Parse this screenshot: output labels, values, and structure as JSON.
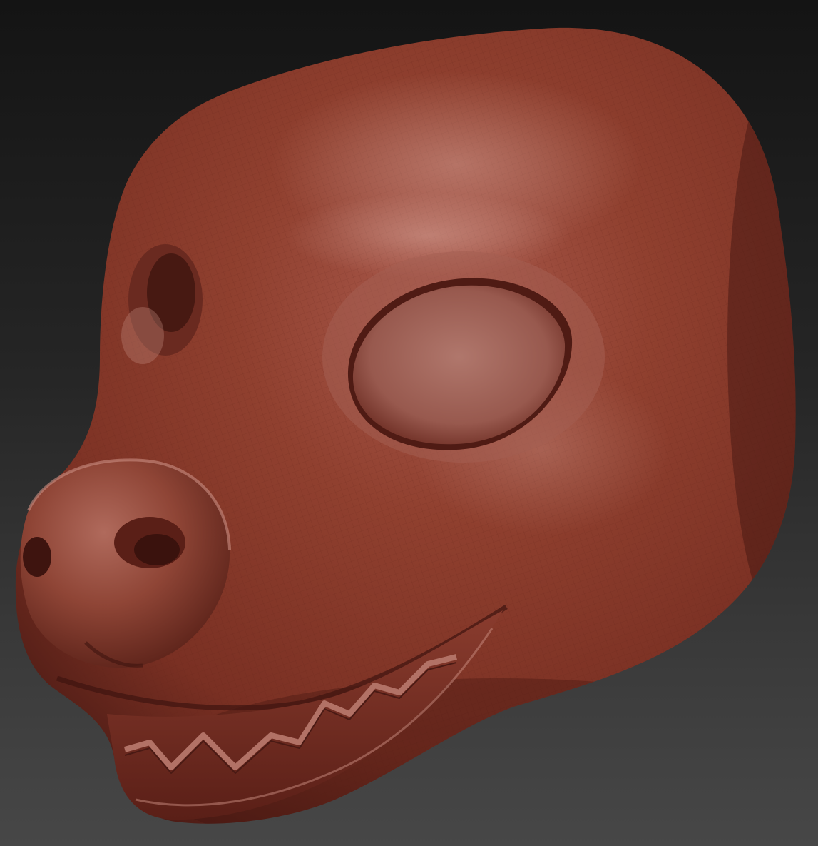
{
  "scene": {
    "subject": "sculpted-head-model",
    "colors": {
      "background_top": "#141414",
      "background_bottom": "#474747",
      "clay_base": "#8e3f33",
      "clay_highlight": "#b8766b",
      "clay_shadow": "#4a1a14",
      "wire_line": "#6e2a22"
    }
  }
}
